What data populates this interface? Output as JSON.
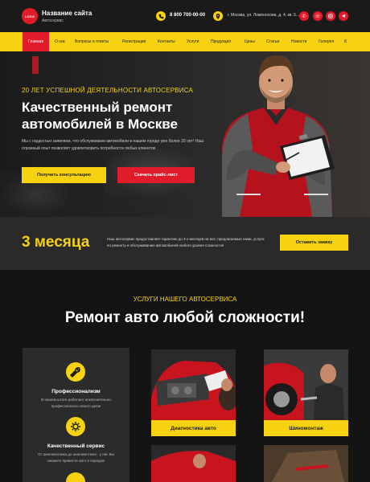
{
  "header": {
    "logo_text": "LOGO",
    "site_name": "Название сайта",
    "site_sub": "Автосервис",
    "phone": "8 800 700-00-00",
    "address": "г. Москва, ул. Ломоносова, д. 4, кв. 5...",
    "social": [
      "whatsapp-icon",
      "viber-icon",
      "instagram-icon",
      "telegram-icon"
    ]
  },
  "nav": {
    "items": [
      "Главная",
      "О нас",
      "Вопросы и ответы",
      "Регистрация",
      "Контакты",
      "Услуги",
      "Продукция",
      "Цены",
      "Статьи",
      "Новости",
      "Галерея",
      "8"
    ]
  },
  "hero": {
    "tagline": "20 ЛЕТ УСПЕШНОЙ ДЕЯТЕЛЬНОСТИ АВТОСЕРВИСА",
    "title_line1": "Качественный ремонт",
    "title_line2": "автомобилей в Москве",
    "text": "Мы с гордостью заявляем, что обслуживаем автомобили в нашем городе уже более 20 лет! Наш огромный опыт позволяет удовлетворить потребности любых клиентов",
    "btn_consult": "Получить консультацию",
    "btn_price": "Скачать прайс-лист"
  },
  "guarantee": {
    "big": "3 месяца",
    "text": "Наш автосервис предоставляет гарантию до 3-х месяцев на все, предлагаемые нами, услуги по ремонту и обслуживанию автомобилей любого уровня сложности!",
    "btn": "Оставить заявку"
  },
  "services": {
    "tag": "УСЛУГИ НАШЕГО АВТОСЕРВИСА",
    "title": "Ремонт авто любой сложности!",
    "advantages": [
      {
        "title": "Профессионализм",
        "text": "В нашем штате работают исключительно профессионалы своего дела!"
      },
      {
        "title": "Качественный сервис",
        "text": "От шиномонтажа до шиномонтажа - у нас Вы сможете привести авто в порядок!"
      }
    ],
    "cards": [
      {
        "label": "Диагностика авто"
      },
      {
        "label": "Шиномонтаж"
      }
    ]
  },
  "colors": {
    "accent": "#f7d211",
    "brand": "#e01b2a",
    "bg": "#141414"
  }
}
